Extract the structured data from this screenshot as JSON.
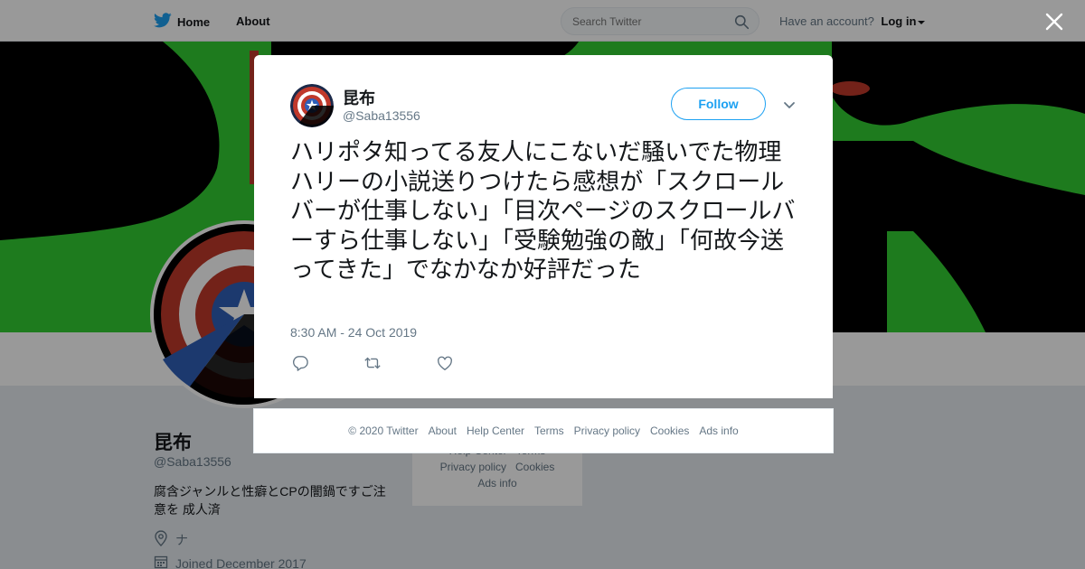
{
  "nav": {
    "home_label": "Home",
    "about_label": "About",
    "search_placeholder": "Search Twitter",
    "account_prompt": "Have an account?",
    "login_label": "Log in"
  },
  "profile": {
    "name": "昆布",
    "handle": "@Saba13556",
    "bio": "腐含ジャンルと性癖とCPの闇鍋ですご注意を 成人済",
    "location": "ナ",
    "joined": "Joined December 2017"
  },
  "side_footer": {
    "row1": [
      "Help Center",
      "Terms"
    ],
    "row2": [
      "Privacy policy",
      "Cookies"
    ],
    "row3": [
      "Ads info"
    ]
  },
  "tweet": {
    "author_name": "昆布",
    "author_handle": "@Saba13556",
    "follow_label": "Follow",
    "text": "ハリポタ知ってる友人にこないだ騒いでた物理ハリーの小説送りつけたら感想が「スクロールバーが仕事しない」「目次ページのスクロールバーすら仕事しない」「受験勉強の敵」「何故今送ってきた」でなかなか好評だった",
    "timestamp": "8:30 AM - 24 Oct 2019"
  },
  "footer": {
    "links": [
      "© 2020 Twitter",
      "About",
      "Help Center",
      "Terms",
      "Privacy policy",
      "Cookies",
      "Ads info"
    ]
  },
  "icons": {
    "logo": "twitter-bird-icon",
    "search": "search-icon",
    "close": "close-icon",
    "more": "chevron-down-icon",
    "reply": "reply-icon",
    "retweet": "retweet-icon",
    "like": "heart-icon",
    "location": "location-pin-icon",
    "calendar": "calendar-icon"
  },
  "colors": {
    "brand": "#1da1f2",
    "banner_green": "#32cd32",
    "text": "#14171a",
    "muted": "#657786"
  }
}
